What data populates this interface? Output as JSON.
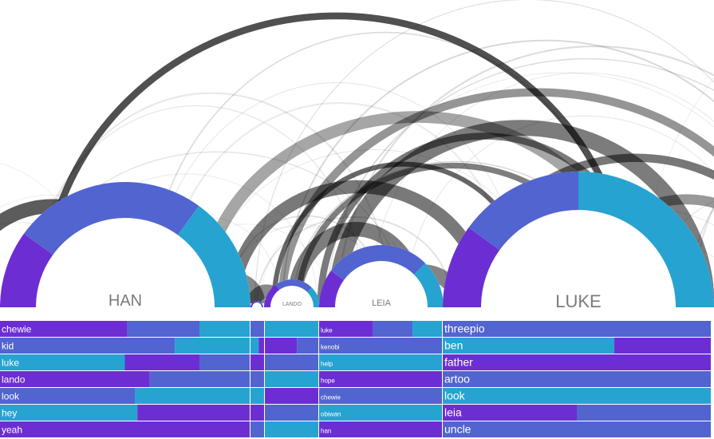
{
  "colors": {
    "purple": "#6c2ed3",
    "blue": "#5264d0",
    "cyan": "#27a3d1",
    "arc": "#000000"
  },
  "chart_data": {
    "type": "arc-diagram",
    "characters": [
      {
        "name": "HAN",
        "ring": [
          0.2,
          0.5,
          0.3
        ],
        "words": [
          {
            "word": "chewie",
            "segments": [
              0.51,
              0.29,
              0.2
            ]
          },
          {
            "word": "kid",
            "segments": [
              0.7,
              0.3,
              0.0
            ]
          },
          {
            "word": "luke",
            "segments": [
              0.5,
              0.3,
              0.2
            ]
          },
          {
            "word": "lando",
            "segments": [
              0.6,
              0.4,
              0.0
            ]
          },
          {
            "word": "look",
            "segments": [
              0.54,
              0.46,
              0.0
            ]
          },
          {
            "word": "hey",
            "segments": [
              0.55,
              0.45,
              0.0
            ]
          },
          {
            "word": "yeah",
            "segments": [
              1.0,
              0.0,
              0.0
            ]
          }
        ]
      },
      {
        "name": "",
        "ring": [
          0.5,
          0.5,
          0.0
        ],
        "words": [
          {
            "word": "",
            "segments": [
              1.0,
              0.0,
              0.0
            ]
          },
          {
            "word": "",
            "segments": [
              0.6,
              0.4,
              0.0
            ]
          },
          {
            "word": "",
            "segments": [
              1.0,
              0.0,
              0.0
            ]
          },
          {
            "word": "",
            "segments": [
              1.0,
              0.0,
              0.0
            ]
          },
          {
            "word": "",
            "segments": [
              1.0,
              0.0,
              0.0
            ]
          },
          {
            "word": "",
            "segments": [
              1.0,
              0.0,
              0.0
            ]
          },
          {
            "word": "",
            "segments": [
              1.0,
              0.0,
              0.0
            ]
          }
        ]
      },
      {
        "name": "LANDO",
        "ring": [
          0.3,
          0.45,
          0.25
        ],
        "words": [
          {
            "word": "",
            "segments": [
              1.0,
              0.0,
              0.0
            ]
          },
          {
            "word": "",
            "segments": [
              0.6,
              0.4,
              0.0
            ]
          },
          {
            "word": "",
            "segments": [
              1.0,
              0.0,
              0.0
            ]
          },
          {
            "word": "",
            "segments": [
              1.0,
              0.0,
              0.0
            ]
          },
          {
            "word": "",
            "segments": [
              1.0,
              0.0,
              0.0
            ]
          },
          {
            "word": "",
            "segments": [
              1.0,
              0.0,
              0.0
            ]
          },
          {
            "word": "",
            "segments": [
              1.0,
              0.0,
              0.0
            ]
          }
        ]
      },
      {
        "name": "LEIA",
        "ring": [
          0.2,
          0.55,
          0.25
        ],
        "words": [
          {
            "word": "luke",
            "segments": [
              0.44,
              0.32,
              0.24
            ]
          },
          {
            "word": "kenobi",
            "segments": [
              1.0,
              0.0,
              0.0
            ]
          },
          {
            "word": "help",
            "segments": [
              1.0,
              0.0,
              0.0
            ]
          },
          {
            "word": "hope",
            "segments": [
              1.0,
              0.0,
              0.0
            ]
          },
          {
            "word": "chewie",
            "segments": [
              1.0,
              0.0,
              0.0
            ]
          },
          {
            "word": "obiwan",
            "segments": [
              1.0,
              0.0,
              0.0
            ]
          },
          {
            "word": "han",
            "segments": [
              1.0,
              0.0,
              0.0
            ]
          }
        ]
      },
      {
        "name": "LUKE",
        "ring": [
          0.2,
          0.3,
          0.5
        ],
        "words": [
          {
            "word": "threepio",
            "segments": [
              1.0,
              0.0,
              0.0
            ]
          },
          {
            "word": "ben",
            "segments": [
              0.64,
              0.36,
              0.0
            ]
          },
          {
            "word": "father",
            "segments": [
              1.0,
              0.0,
              0.0
            ]
          },
          {
            "word": "artoo",
            "segments": [
              1.0,
              0.0,
              0.0
            ]
          },
          {
            "word": "look",
            "segments": [
              1.0,
              0.0,
              0.0
            ]
          },
          {
            "word": "leia",
            "segments": [
              0.5,
              0.5,
              0.0
            ]
          },
          {
            "word": "uncle",
            "segments": [
              1.0,
              0.0,
              0.0
            ]
          }
        ]
      }
    ]
  }
}
